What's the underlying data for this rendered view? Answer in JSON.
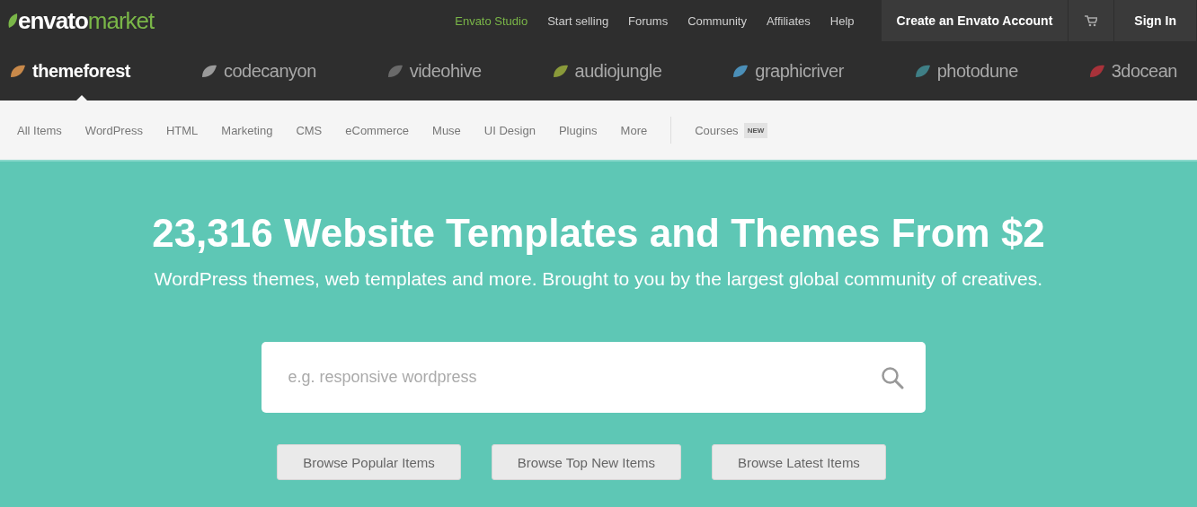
{
  "header": {
    "logo": {
      "brand": "envato",
      "suffix": "market"
    },
    "links": [
      {
        "label": "Envato Studio",
        "kind": "accent"
      },
      {
        "label": "Start selling",
        "kind": "plain"
      },
      {
        "label": "Forums",
        "kind": "plain"
      },
      {
        "label": "Community",
        "kind": "plain"
      },
      {
        "label": "Affiliates",
        "kind": "plain"
      },
      {
        "label": "Help",
        "kind": "plain"
      }
    ],
    "create_account": "Create an Envato Account",
    "sign_in": "Sign In"
  },
  "marketplaces": [
    {
      "label": "themeforest",
      "selected": true,
      "color": "#c8894a"
    },
    {
      "label": "codecanyon",
      "selected": false,
      "color": "#9a9a9a"
    },
    {
      "label": "videohive",
      "selected": false,
      "color": "#6a6a6a"
    },
    {
      "label": "audiojungle",
      "selected": false,
      "color": "#8a9a3a"
    },
    {
      "label": "graphicriver",
      "selected": false,
      "color": "#4b8fb8"
    },
    {
      "label": "photodune",
      "selected": false,
      "color": "#3f7f86"
    },
    {
      "label": "3docean",
      "selected": false,
      "color": "#a8323a"
    }
  ],
  "categories": [
    {
      "label": "All Items"
    },
    {
      "label": "WordPress"
    },
    {
      "label": "HTML"
    },
    {
      "label": "Marketing"
    },
    {
      "label": "CMS"
    },
    {
      "label": "eCommerce"
    },
    {
      "label": "Muse"
    },
    {
      "label": "UI Design"
    },
    {
      "label": "Plugins"
    },
    {
      "label": "More"
    }
  ],
  "courses": {
    "label": "Courses",
    "badge": "NEW"
  },
  "hero": {
    "title": "23,316 Website Templates and Themes From $2",
    "subtitle": "WordPress themes, web templates and more. Brought to you by the largest global community of creatives.",
    "search": {
      "placeholder": "e.g. responsive wordpress"
    },
    "buttons": [
      "Browse Popular Items",
      "Browse Top New Items",
      "Browse Latest Items"
    ]
  }
}
